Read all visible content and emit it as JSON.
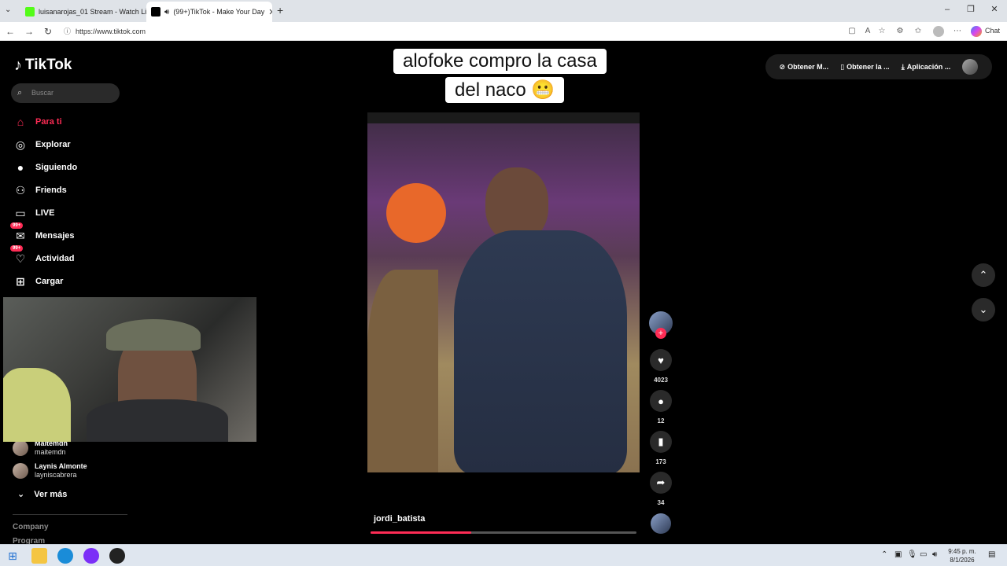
{
  "browser": {
    "tabs": [
      {
        "title": "luisanarojas_01 Stream - Watch Li",
        "favicon_color": "#53fc18"
      },
      {
        "title": "(99+)TikTok - Make Your Day",
        "favicon_color": "#000000"
      }
    ],
    "new_tab": "+",
    "url": "https://www.tiktok.com",
    "chat_label": "Chat"
  },
  "tiktok": {
    "logo_text": "TikTok",
    "search_placeholder": "Buscar",
    "nav": [
      {
        "label": "Para ti",
        "icon": "home-icon",
        "glyph": "⌂",
        "active": true
      },
      {
        "label": "Explorar",
        "icon": "compass-icon",
        "glyph": "◎"
      },
      {
        "label": "Siguiendo",
        "icon": "following-avatar-icon",
        "glyph": "●"
      },
      {
        "label": "Friends",
        "icon": "friends-icon",
        "glyph": "⚇"
      },
      {
        "label": "LIVE",
        "icon": "live-tv-icon",
        "glyph": "▭"
      },
      {
        "label": "Mensajes",
        "icon": "messages-icon",
        "glyph": "✉",
        "badge": "99+"
      },
      {
        "label": "Actividad",
        "icon": "activity-icon",
        "glyph": "♡",
        "badge": "99+"
      },
      {
        "label": "Cargar",
        "icon": "upload-icon",
        "glyph": "⊞"
      }
    ],
    "following": [
      {
        "name": "Maitemdn",
        "user": "maitemdn"
      },
      {
        "name": "Laynis Almonte",
        "user": "layniscabrera"
      }
    ],
    "see_more": "Ver más",
    "footer_links": [
      "Company",
      "Program"
    ],
    "top_right": [
      "Obtener M...",
      "Obtener la ...",
      "Aplicación ..."
    ],
    "caption_lines": [
      "alofoke compro la casa",
      "del naco 😬"
    ],
    "username": "jordi_batista",
    "progress": 0.38,
    "actions": {
      "likes": "4023",
      "comments": "12",
      "saves": "173",
      "shares": "34"
    }
  },
  "taskbar": {
    "time": "9:45 p. m.",
    "date": "8/1/2026"
  }
}
